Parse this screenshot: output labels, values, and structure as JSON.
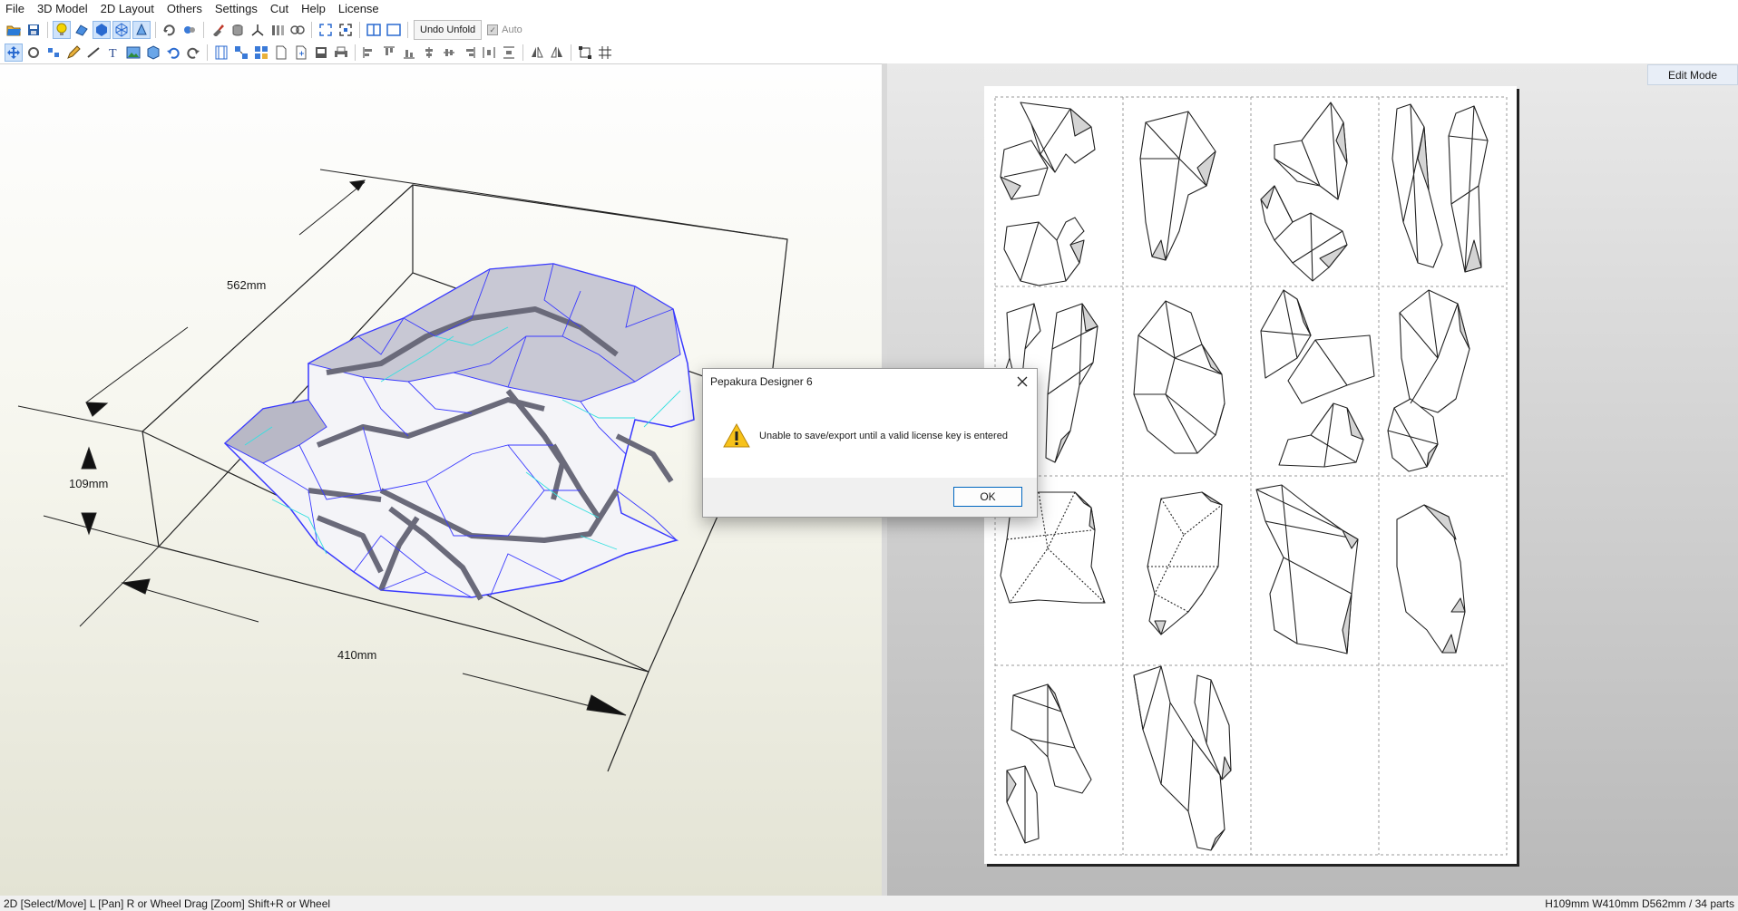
{
  "menu": [
    "File",
    "3D Model",
    "2D Layout",
    "Others",
    "Settings",
    "Cut",
    "Help",
    "License"
  ],
  "toolbar": {
    "undo_unfold": "Undo Unfold",
    "auto_label": "Auto",
    "auto_checked": true
  },
  "view3d": {
    "dims": {
      "depth": "562mm",
      "height": "109mm",
      "width": "410mm"
    }
  },
  "view2d": {
    "edit_mode": "Edit Mode"
  },
  "dialog": {
    "title": "Pepakura Designer 6",
    "message": "Unable to save/export until a valid license key is entered",
    "ok": "OK"
  },
  "status": {
    "left": "2D [Select/Move] L [Pan] R or Wheel Drag [Zoom] Shift+R or Wheel",
    "right": "H109mm W410mm D562mm / 34 parts"
  },
  "colors": {
    "edge": "#3a3aff",
    "fold": "#36e0e0",
    "highlight": "#cfe3fb"
  }
}
